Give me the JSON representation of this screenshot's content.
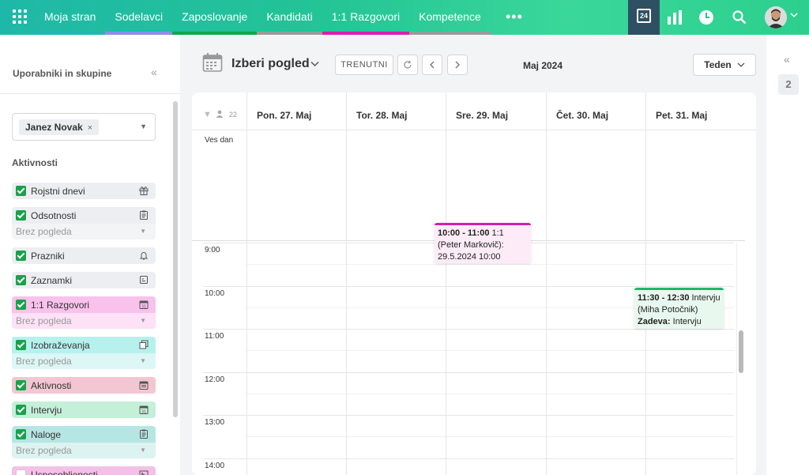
{
  "nav": {
    "items": [
      {
        "label": "Moja stran",
        "bar": "#22b8b0"
      },
      {
        "label": "Sodelavci",
        "bar": "#8f8ee6"
      },
      {
        "label": "Zaposlovanje",
        "bar": "#0ea84a"
      },
      {
        "label": "Kandidati",
        "bar": "#9a9a9a"
      },
      {
        "label": "1:1 Razgovori",
        "bar": "#d81fb0"
      },
      {
        "label": "Kompetence",
        "bar": "#9a9a9a"
      }
    ],
    "more": "•••",
    "calendar_day": "24"
  },
  "sidebar": {
    "title": "Uporabniki in skupine",
    "collapse": "«",
    "user_chip": "Janez Novak",
    "chip_remove": "×",
    "activities_title": "Aktivnosti",
    "activities": [
      {
        "label": "Rojstni dnevi",
        "bg": "#eceef1",
        "icon": "gift-icon",
        "checked": true
      },
      {
        "label": "Odsotnosti",
        "bg": "#eceef1",
        "icon": "clipboard-icon",
        "checked": true,
        "sub": "Brez pogleda"
      },
      {
        "label": "Prazniki",
        "bg": "#eceef1",
        "icon": "bell-icon",
        "checked": true
      },
      {
        "label": "Zaznamki",
        "bg": "#eceef1",
        "icon": "note-icon",
        "checked": true
      },
      {
        "label": "1:1 Razgovori",
        "bg": "#f9c2ec",
        "subbg": "#fde1f6",
        "icon": "calendar-icon",
        "checked": true,
        "sub": "Brez pogleda"
      },
      {
        "label": "Izobraževanja",
        "bg": "#b7f1ee",
        "subbg": "#dcf7f5",
        "icon": "copy-icon",
        "checked": true,
        "sub": "Brez pogleda"
      },
      {
        "label": "Aktivnosti",
        "bg": "#f2c6d2",
        "icon": "calendar-list-icon",
        "checked": true
      },
      {
        "label": "Intervju",
        "bg": "#c4efd9",
        "icon": "calendar-icon",
        "checked": true
      },
      {
        "label": "Naloge",
        "bg": "#b6e6e3",
        "subbg": "#dcf3f1",
        "icon": "clipboard-icon",
        "checked": true,
        "sub": "Brez pogleda"
      },
      {
        "label": "Usposobljenosti",
        "bg": "#f3c1e8",
        "icon": "image-icon",
        "checked": false
      }
    ]
  },
  "toolbar": {
    "view_title": "Izberi pogled",
    "today": "TRENUTNI",
    "month": "Maj 2024",
    "view_mode": "Teden"
  },
  "calendar": {
    "people_count": "22",
    "all_day": "Ves dan",
    "days": [
      "Pon. 27. Maj",
      "Tor. 28. Maj",
      "Sre. 29. Maj",
      "Čet. 30. Maj",
      "Pet. 31. Maj"
    ],
    "hours": [
      "9:00",
      "10:00",
      "11:00",
      "12:00",
      "13:00",
      "14:00"
    ],
    "events": [
      {
        "time": "10:00 - 11:00",
        "text": "1:1 (Peter Markovič): 29.5.2024 10:00"
      },
      {
        "time": "11:30 - 12:30",
        "text": "Intervju (Miha Potočnik)",
        "subject_label": "Zadeva:",
        "subject": "Intervju"
      }
    ]
  },
  "rpanel": {
    "collapse": "«",
    "count": "2"
  }
}
